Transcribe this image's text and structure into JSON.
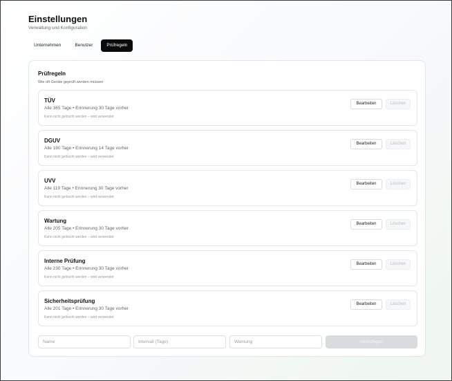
{
  "header": {
    "title": "Einstellungen",
    "subtitle": "Verwaltung und Konfiguration"
  },
  "tabs": [
    {
      "label": "Unternehmen",
      "active": false
    },
    {
      "label": "Benutzer",
      "active": false
    },
    {
      "label": "Prüfregeln",
      "active": true
    }
  ],
  "section": {
    "title": "Prüfregeln",
    "subtitle": "Wie oft Geräte geprüft werden müssen"
  },
  "actions": {
    "edit": "Bearbeiten",
    "delete": "Löschen"
  },
  "rules": [
    {
      "name": "TÜV",
      "info": "Alle 365 Tage • Erinnerung 30 Tage vorher",
      "note": "Kann nicht gelöscht werden – wird verwendet"
    },
    {
      "name": "DGUV",
      "info": "Alle 180 Tage • Erinnerung 14 Tage vorher",
      "note": "Kann nicht gelöscht werden – wird verwendet"
    },
    {
      "name": "UVV",
      "info": "Alle 119 Tage • Erinnerung 30 Tage vorher",
      "note": "Kann nicht gelöscht werden – wird verwendet"
    },
    {
      "name": "Wartung",
      "info": "Alle 205 Tage • Erinnerung 30 Tage vorher",
      "note": "Kann nicht gelöscht werden – wird verwendet"
    },
    {
      "name": "Interne Prüfung",
      "info": "Alle 230 Tage • Erinnerung 30 Tage vorher",
      "note": "Kann nicht gelöscht werden – wird verwendet"
    },
    {
      "name": "Sicherheitsprüfung",
      "info": "Alle 201 Tage • Erinnerung 30 Tage vorher",
      "note": "Kann nicht gelöscht werden – wird verwendet"
    }
  ],
  "form": {
    "name_placeholder": "Name",
    "interval_placeholder": "Intervall (Tage)",
    "warning_placeholder": "Warnung",
    "add_label": "Hinzufügen"
  }
}
